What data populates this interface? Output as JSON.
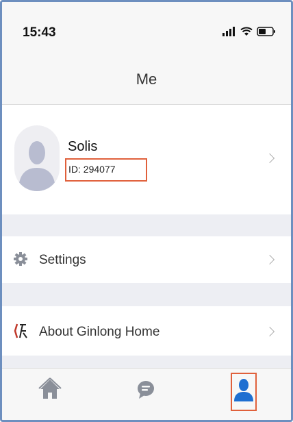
{
  "status_bar": {
    "time": "15:43"
  },
  "header": {
    "title": "Me"
  },
  "profile": {
    "name": "Solis",
    "id_text": "ID: 294077"
  },
  "menu": [
    {
      "label": "Settings",
      "icon": "gear-icon"
    },
    {
      "label": "About Ginlong Home",
      "icon": "ginlong-logo-icon"
    }
  ],
  "tabbar": {
    "tabs": [
      {
        "name": "home",
        "icon": "home-icon",
        "active": false
      },
      {
        "name": "messages",
        "icon": "chat-bubble-icon",
        "active": false
      },
      {
        "name": "me",
        "icon": "person-icon",
        "active": true
      }
    ]
  },
  "colors": {
    "accent": "#1f6fd1",
    "icon_gray": "#8a8f99",
    "highlight": "#e0603b",
    "frame": "#6d8fbf"
  }
}
